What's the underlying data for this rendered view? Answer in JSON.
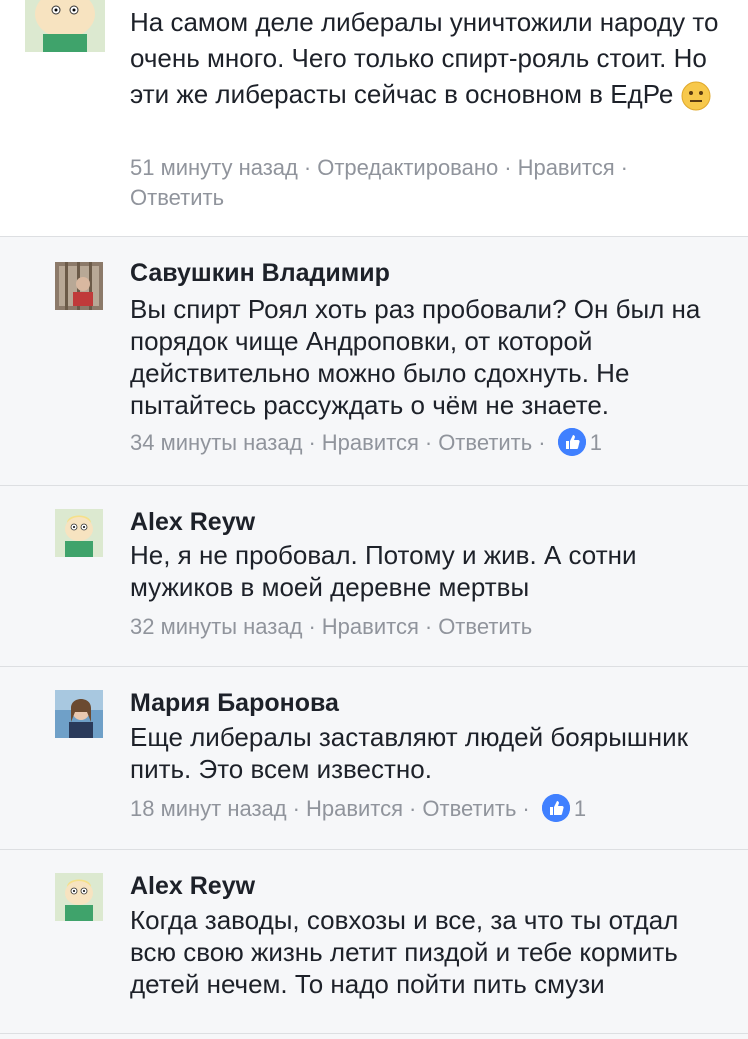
{
  "comments": [
    {
      "text": "На самом деле либералы уничтожили народу то очень много. Чего только спирт-рояль стоит. Но эти же либерасты сейчас в основном в ЕдРе",
      "emoji": "neutral-face-emoji",
      "time": "51 минуту назад",
      "edited": "Отредактировано",
      "like": "Нравится",
      "reply": "Ответить"
    },
    {
      "author": "Савушкин Владимир",
      "text": "Вы спирт Роял хоть раз пробовали? Он был на порядок чище Андроповки, от которой действительно можно было сдохнуть. Не пытайтесь рассуждать о чём не знаете.",
      "time": "34 минуты назад",
      "like": "Нравится",
      "reply": "Ответить",
      "likes_count": "1"
    },
    {
      "author": "Alex Reyw",
      "text": "Не,  я не пробовал. Потому и жив.  А сотни мужиков в моей деревне мертвы",
      "time": "32 минуты назад",
      "like": "Нравится",
      "reply": "Ответить"
    },
    {
      "author": "Мария Баронова",
      "text": "Еще либералы заставляют людей боярышник пить. Это всем известно.",
      "time": "18 минут назад",
      "like": "Нравится",
      "reply": "Ответить",
      "likes_count": "1"
    },
    {
      "author": "Alex Reyw",
      "text": "Когда заводы,  совхозы и все,  за что ты отдал всю свою жизнь летит пиздой и тебе кормить детей нечем.  То надо пойти пить смузи",
      "time": "",
      "like": "",
      "reply": ""
    }
  ],
  "colors": {
    "link": "#90949c",
    "like_badge": "#4080ff",
    "gray_bg": "#f6f7f9"
  }
}
